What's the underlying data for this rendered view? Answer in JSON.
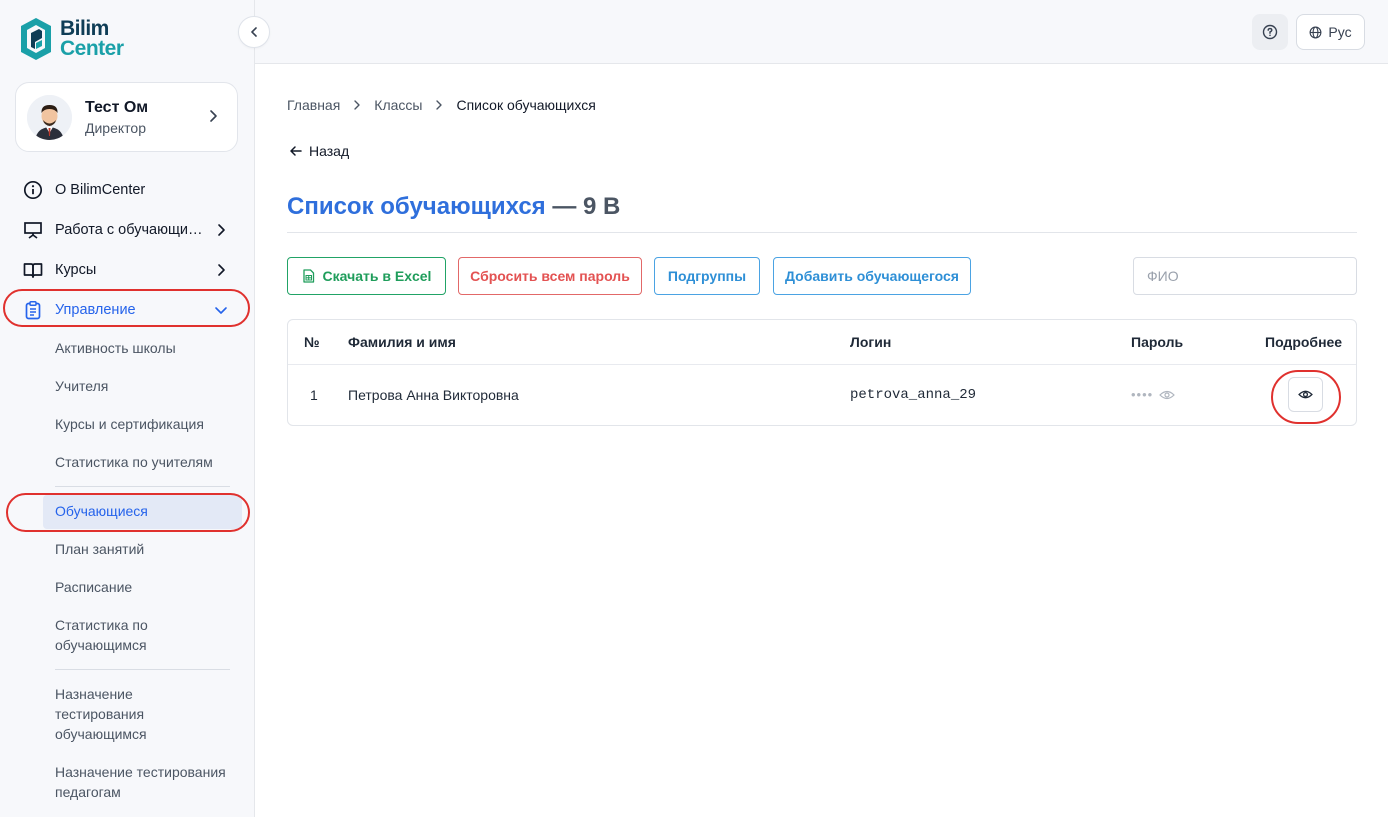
{
  "brand": {
    "line1": "Bilim",
    "line2": "Center"
  },
  "profile": {
    "name": "Тест Ом",
    "role": "Директор"
  },
  "nav": [
    {
      "label": "О BilimCenter"
    },
    {
      "label": "Работа с обучающимися"
    },
    {
      "label": "Курсы"
    },
    {
      "label": "Управление"
    }
  ],
  "submenu": {
    "group1": [
      "Активность школы",
      "Учителя",
      "Курсы и сертификация",
      "Статистика по учителям"
    ],
    "active": "Обучающиеся",
    "group2": [
      "План занятий",
      "Расписание",
      "Статистика по обучающимся"
    ],
    "group3": [
      "Назначение тестирования обучающимся",
      "Назначение тестирования педагогам"
    ]
  },
  "topbar": {
    "lang": "Рус"
  },
  "breadcrumb": [
    "Главная",
    "Классы",
    "Список обучающихся"
  ],
  "back": "Назад",
  "title": {
    "main": "Список обучающихся",
    "suffix": "— 9 В"
  },
  "actions": {
    "excel": "Скачать в Excel",
    "reset": "Сбросить всем пароль",
    "subgroups": "Подгруппы",
    "add": "Добавить обучающегося"
  },
  "search": {
    "placeholder": "ФИО",
    "value": ""
  },
  "table": {
    "headers": {
      "num": "№",
      "name": "Фамилия и имя",
      "login": "Логин",
      "password": "Пароль",
      "details": "Подробнее"
    },
    "rows": [
      {
        "num": "1",
        "name": "Петрова Анна Викторовна",
        "login": "petrova_anna_29",
        "password": "••••"
      }
    ]
  },
  "colors": {
    "accent": "#2f6fdc",
    "excel": "#1f9d5b",
    "danger": "#e35252",
    "info": "#2e8fd6",
    "highlight": "#e0312e"
  }
}
